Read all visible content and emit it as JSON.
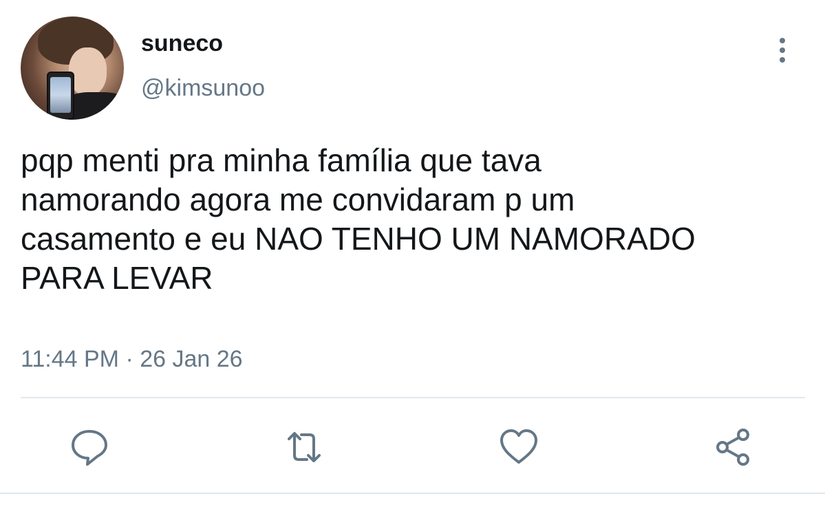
{
  "user": {
    "display_name": "suneco",
    "handle": "@kimsunoo"
  },
  "tweet": {
    "text": "pqp menti pra minha família que tava\nnamorando agora me convidaram p um\ncasamento e eu NAO TENHO UM NAMORADO\nPARA LEVAR",
    "timestamp": "11:44 PM · 26 Jan 26"
  },
  "icons": {
    "more": "more-vertical-icon",
    "reply": "reply-icon",
    "retweet": "retweet-icon",
    "like": "heart-icon",
    "share": "share-icon"
  },
  "colors": {
    "text": "#14171a",
    "secondary_text": "#657786",
    "divider": "#e1e8ed",
    "background": "#ffffff"
  }
}
